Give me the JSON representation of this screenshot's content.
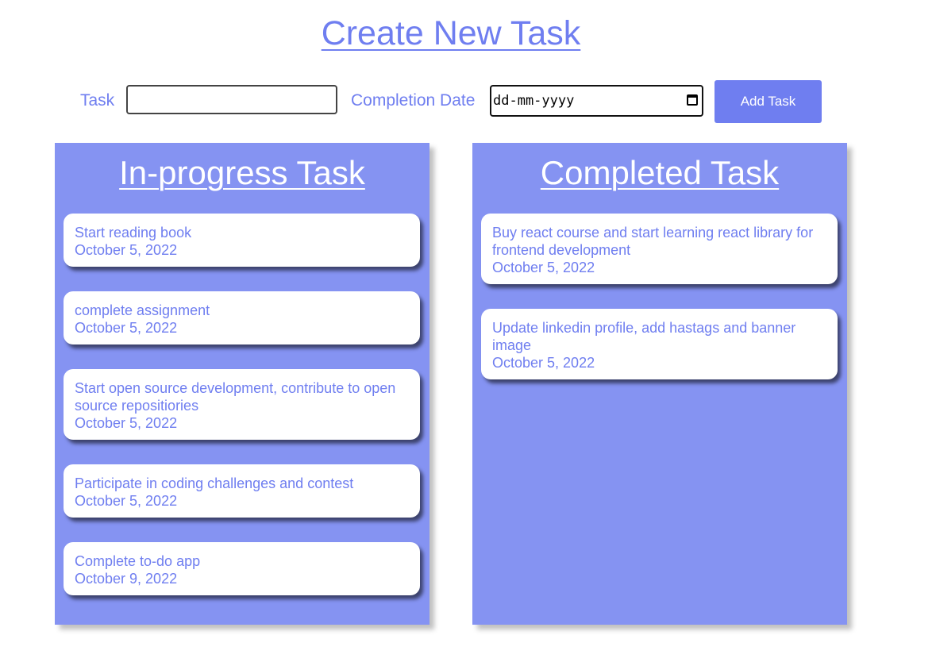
{
  "header": {
    "title": "Create New Task"
  },
  "form": {
    "task_label": "Task",
    "task_value": "",
    "date_label": "Completion Date",
    "date_placeholder": "dd-mm-yyyy",
    "add_button_label": "Add Task"
  },
  "in_progress": {
    "title": "In-progress Task",
    "items": [
      {
        "text": "Start reading book",
        "date": "October 5, 2022"
      },
      {
        "text": "complete assignment",
        "date": "October 5, 2022"
      },
      {
        "text": "Start open source development, contribute to open source repositiories",
        "date": "October 5, 2022"
      },
      {
        "text": "Participate in coding challenges and contest",
        "date": "October 5, 2022"
      },
      {
        "text": "Complete to-do app",
        "date": "October 9, 2022"
      }
    ]
  },
  "completed": {
    "title": "Completed Task",
    "items": [
      {
        "text": "Buy react course and start learning react library for frontend development",
        "date": "October 5, 2022"
      },
      {
        "text": "Update linkedin profile, add hastags and banner image",
        "date": "October 5, 2022"
      }
    ]
  },
  "colors": {
    "accent": "#6f7ef0",
    "panel": "#8593f2",
    "card": "#ffffff"
  }
}
